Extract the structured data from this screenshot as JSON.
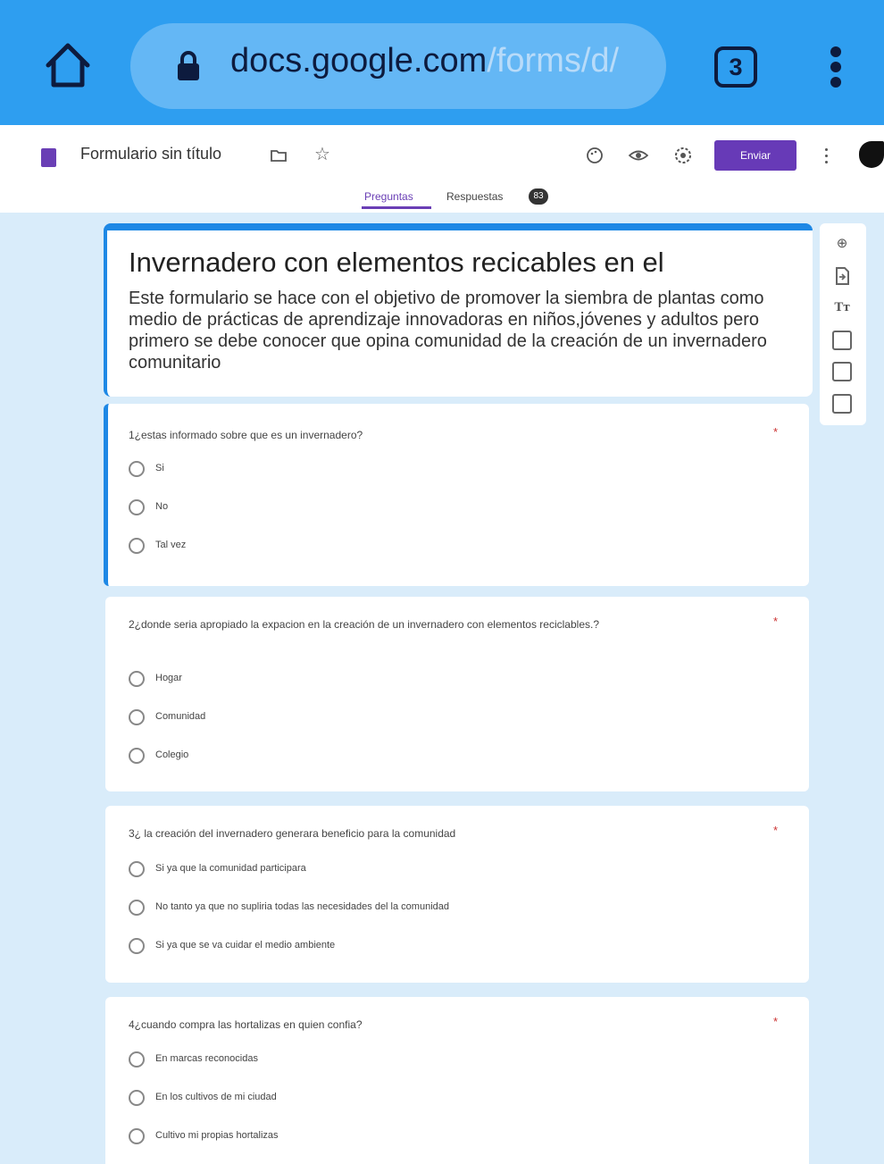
{
  "browser": {
    "url_host": "docs.google.com",
    "url_path": "/forms/d/",
    "tab_count": "3"
  },
  "app": {
    "doc_title": "Formulario sin título",
    "send_label": "Enviar",
    "tabs": [
      {
        "label": "Preguntas",
        "active": true
      },
      {
        "label": "Respuestas",
        "active": false
      }
    ],
    "responses_count": "83"
  },
  "form": {
    "title": "Invernadero con elementos recicables en el",
    "description": "Este formulario se hace con el objetivo de promover la siembra de plantas como medio de prácticas de aprendizaje innovadoras en niños,jóvenes y adultos pero primero se debe conocer que opina comunidad de la creación de un invernadero comunitario"
  },
  "side_toolbar": [
    "add-question-icon",
    "import-questions-icon",
    "add-title-icon",
    "add-image-icon",
    "add-video-icon",
    "add-section-icon"
  ],
  "side_toolbar_glyphs": {
    "add_question": "⊕",
    "add_title": "Tт"
  },
  "questions": [
    {
      "label": "1¿estas informado sobre que es un invernadero?",
      "required": "*",
      "options": [
        "Si",
        "No",
        "Tal vez"
      ]
    },
    {
      "label": "2¿donde seria apropiado la expacion en la creación de un invernadero con elementos reciclables.?",
      "required": "*",
      "options": [
        "Hogar",
        "Comunidad",
        "Colegio"
      ]
    },
    {
      "label": "3¿ la creación del invernadero generara beneficio para la comunidad",
      "required": "*",
      "options": [
        "Si ya que la comunidad participara",
        "No tanto ya que no supliria todas las necesidades del la comunidad",
        "Si ya que se va cuidar el medio ambiente"
      ]
    },
    {
      "label": "4¿cuando compra las hortalizas en quien confia?",
      "required": "*",
      "options": [
        "En marcas reconocidas",
        "En los cultivos de mi ciudad",
        "Cultivo mi propias hortalizas"
      ]
    }
  ],
  "colors": {
    "browser_bar": "#2e9ef0",
    "accent_purple": "#673ab7",
    "card_accent_blue": "#1e88e5",
    "canvas_bg": "#d9ecfa"
  }
}
